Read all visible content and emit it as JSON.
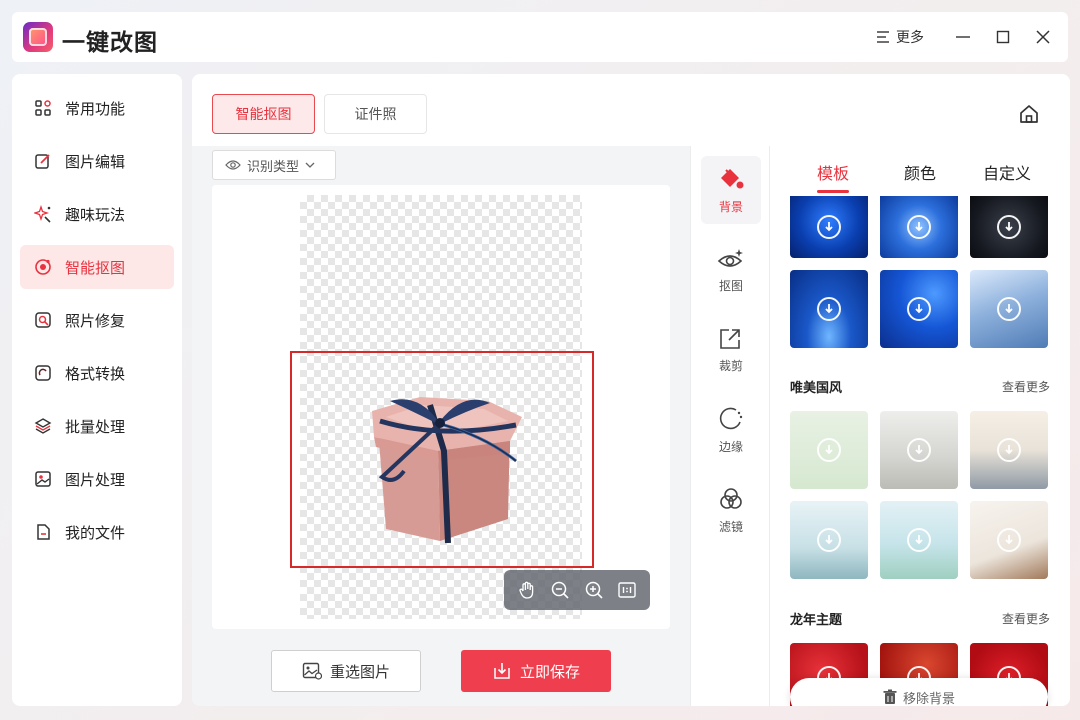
{
  "app": {
    "title": "一键改图",
    "more_label": "更多"
  },
  "sidebar": {
    "items": [
      {
        "label": "常用功能",
        "icon": "grid-icon"
      },
      {
        "label": "图片编辑",
        "icon": "edit-icon"
      },
      {
        "label": "趣味玩法",
        "icon": "sparkle-icon"
      },
      {
        "label": "智能抠图",
        "icon": "cutout-icon",
        "active": true
      },
      {
        "label": "照片修复",
        "icon": "repair-icon"
      },
      {
        "label": "格式转换",
        "icon": "convert-icon"
      },
      {
        "label": "批量处理",
        "icon": "layers-icon"
      },
      {
        "label": "图片处理",
        "icon": "image-icon"
      },
      {
        "label": "我的文件",
        "icon": "file-icon"
      }
    ]
  },
  "main": {
    "tabs": [
      {
        "label": "智能抠图",
        "active": true
      },
      {
        "label": "证件照"
      }
    ],
    "recognize_type_label": "识别类型",
    "reselect_label": "重选图片",
    "save_label": "立即保存"
  },
  "tools": [
    {
      "label": "背景",
      "icon": "paint-bucket-icon",
      "active": true
    },
    {
      "label": "抠图",
      "icon": "eye-sparkle-icon"
    },
    {
      "label": "裁剪",
      "icon": "crop-icon"
    },
    {
      "label": "边缘",
      "icon": "edge-icon"
    },
    {
      "label": "滤镜",
      "icon": "filter-icon"
    }
  ],
  "right_panel": {
    "tabs": [
      {
        "label": "模板",
        "active": true
      },
      {
        "label": "颜色"
      },
      {
        "label": "自定义"
      }
    ],
    "sections": [
      {
        "title": "唯美国风",
        "more": "查看更多"
      },
      {
        "title": "龙年主题",
        "more": "查看更多"
      }
    ],
    "remove_bg_label": "移除背景"
  },
  "colors": {
    "accent": "#e8333f",
    "active_bg": "#fde7e7"
  }
}
